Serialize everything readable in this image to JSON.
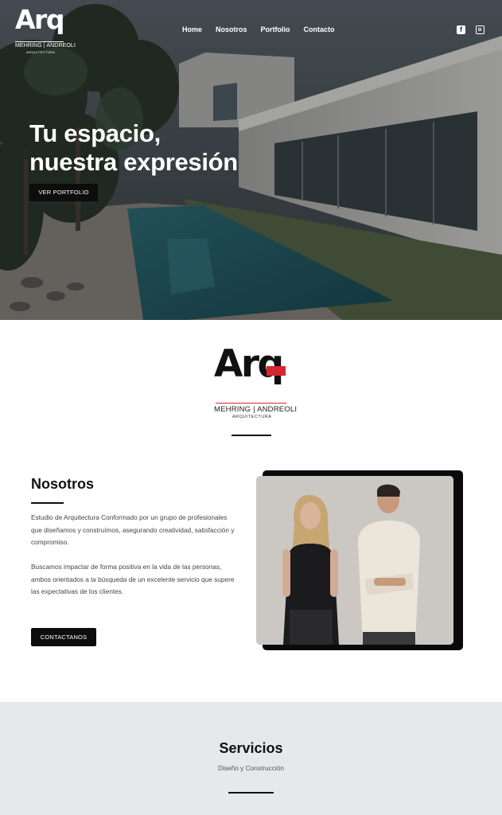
{
  "brand": {
    "logo_mark": "Arq",
    "names": "MEHRING | ANDREOLI",
    "subtitle": "ARQUITECTURA",
    "accent_color": "#d7262d"
  },
  "nav": {
    "items": [
      {
        "label": "Home"
      },
      {
        "label": "Nosotros"
      },
      {
        "label": "Portfolio"
      },
      {
        "label": "Contacto"
      }
    ],
    "social": [
      {
        "icon": "facebook-icon"
      },
      {
        "icon": "instagram-icon"
      }
    ]
  },
  "hero": {
    "title_line1": "Tu espacio,",
    "title_line2": "nuestra expresión",
    "button_label": "VER PORTFOLIO"
  },
  "nosotros": {
    "title": "Nosotros",
    "paragraph1": "Estudio de Arquitectura Conformado por un grupo de profesionales que diseñamos y construímos, asegurando creatividad, satisfacción y compromiso.",
    "paragraph2": "Buscamos impactar de forma positiva en la vida de las personas, ambos orientados a la búsqueda de un excelente servicio que supere las expectativas de los clientes.",
    "button_label": "CONTACTANOS"
  },
  "servicios": {
    "title": "Servicios",
    "subtitle": "Diseño y Construcción"
  }
}
